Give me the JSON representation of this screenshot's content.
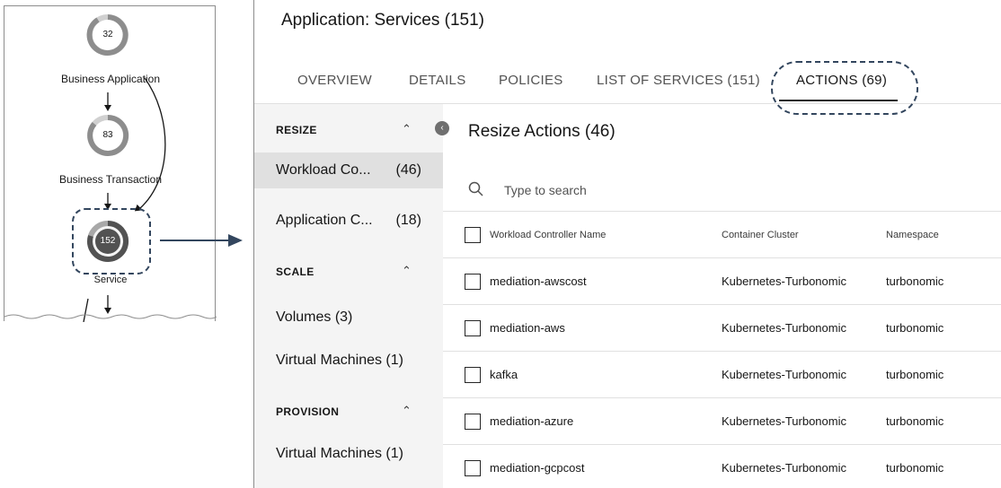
{
  "topology": {
    "nodes": [
      {
        "count": "32",
        "label": "Business Application"
      },
      {
        "count": "83",
        "label": "Business Transaction"
      },
      {
        "count": "152",
        "label": "Service"
      }
    ]
  },
  "page": {
    "title": "Application: Services (151)"
  },
  "tabs": [
    {
      "label": "OVERVIEW"
    },
    {
      "label": "DETAILS"
    },
    {
      "label": "POLICIES"
    },
    {
      "label": "LIST OF SERVICES (151)"
    },
    {
      "label": "ACTIONS (69)",
      "active": true
    }
  ],
  "sidebar": {
    "sections": [
      {
        "title": "RESIZE",
        "items": [
          {
            "label": "Workload Co...",
            "count": "(46)",
            "selected": true
          },
          {
            "label": "Application C...",
            "count": "(18)"
          }
        ]
      },
      {
        "title": "SCALE",
        "items": [
          {
            "label": "Volumes (3)"
          },
          {
            "label": "Virtual Machines (1)"
          }
        ]
      },
      {
        "title": "PROVISION",
        "items": [
          {
            "label": "Virtual Machines (1)"
          }
        ]
      }
    ]
  },
  "content": {
    "title": "Resize Actions (46)",
    "search_placeholder": "Type to search"
  },
  "table": {
    "columns": [
      "Workload Controller Name",
      "Container Cluster",
      "Namespace"
    ],
    "rows": [
      [
        "mediation-awscost",
        "Kubernetes-Turbonomic",
        "turbonomic"
      ],
      [
        "mediation-aws",
        "Kubernetes-Turbonomic",
        "turbonomic"
      ],
      [
        "kafka",
        "Kubernetes-Turbonomic",
        "turbonomic"
      ],
      [
        "mediation-azure",
        "Kubernetes-Turbonomic",
        "turbonomic"
      ],
      [
        "mediation-gcpcost",
        "Kubernetes-Turbonomic",
        "turbonomic"
      ]
    ]
  },
  "colors": {
    "ring_light": "#d0d0d0",
    "ring_dark": "#6f6f6f",
    "highlight_dash": "#33465e",
    "sidebar_bg": "#f4f4f4",
    "selected_bg": "#e0e0e0"
  },
  "icons": {
    "search": "search-icon",
    "collapse": "chevron-left-icon",
    "section_toggle": "chevron-up-icon"
  }
}
